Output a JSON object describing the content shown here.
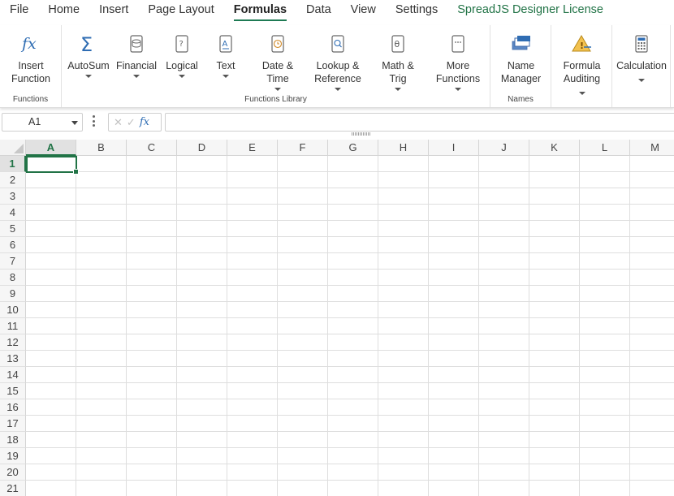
{
  "menu": {
    "tabs": [
      {
        "label": "File"
      },
      {
        "label": "Home"
      },
      {
        "label": "Insert"
      },
      {
        "label": "Page Layout"
      },
      {
        "label": "Formulas"
      },
      {
        "label": "Data"
      },
      {
        "label": "View"
      },
      {
        "label": "Settings"
      },
      {
        "label": "SpreadJS Designer License"
      }
    ],
    "active": "Formulas"
  },
  "ribbon": {
    "functions": {
      "label": "Functions",
      "insert_function": {
        "line1": "Insert",
        "line2": "Function",
        "icon": "fx-icon"
      }
    },
    "library": {
      "label": "Functions Library",
      "autosum": {
        "line1": "AutoSum",
        "icon": "sigma-icon"
      },
      "financial": {
        "line1": "Financial",
        "icon": "coin-stack-icon"
      },
      "logical": {
        "line1": "Logical",
        "icon": "question-book-icon"
      },
      "text": {
        "line1": "Text",
        "icon": "letter-a-book-icon"
      },
      "date_time": {
        "line1": "Date &",
        "line2": "Time",
        "icon": "clock-book-icon"
      },
      "lookup_reference": {
        "line1": "Lookup &",
        "line2": "Reference",
        "icon": "magnifier-book-icon"
      },
      "math_trig": {
        "line1": "Math &",
        "line2": "Trig",
        "icon": "theta-book-icon"
      },
      "more_functions": {
        "line1": "More",
        "line2": "Functions",
        "icon": "ellipsis-book-icon"
      }
    },
    "names": {
      "label": "Names",
      "name_manager": {
        "line1": "Name",
        "line2": "Manager",
        "icon": "name-tags-icon"
      }
    },
    "auditing": {
      "formula_auditing": {
        "line1": "Formula",
        "line2": "Auditing",
        "icon": "warning-triangle-icon"
      }
    },
    "calculation": {
      "calculation": {
        "line1": "Calculation",
        "icon": "calculator-icon"
      }
    }
  },
  "formula_bar": {
    "name_box": "A1",
    "formula": ""
  },
  "grid": {
    "columns": [
      "A",
      "B",
      "C",
      "D",
      "E",
      "F",
      "G",
      "H",
      "I",
      "J",
      "K",
      "L",
      "M"
    ],
    "rows": [
      "1",
      "2",
      "3",
      "4",
      "5",
      "6",
      "7",
      "8",
      "9",
      "10",
      "11",
      "12",
      "13",
      "14",
      "15",
      "16",
      "17",
      "18",
      "19",
      "20",
      "21"
    ],
    "active_cell": "A1"
  },
  "colors": {
    "accent": "#217346",
    "icon_blue": "#2f6db3"
  }
}
